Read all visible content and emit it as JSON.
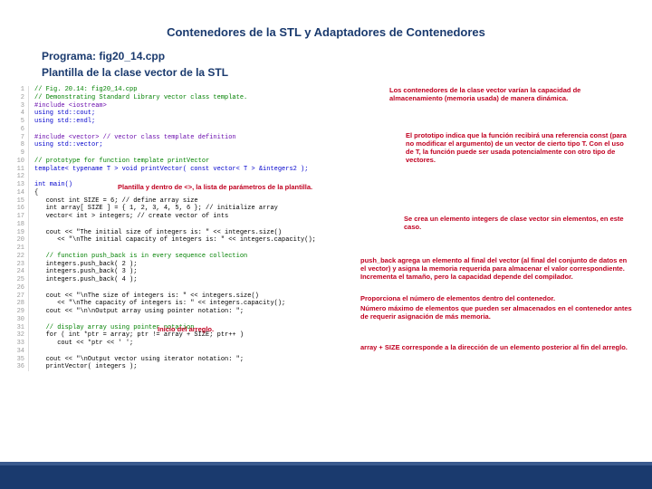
{
  "title": "Contenedores de la STL y Adaptadores de Contenedores",
  "subtitle1": "Programa: fig20_14.cpp",
  "subtitle2": "Plantilla de la clase vector de la STL",
  "code": [
    {
      "n": 1,
      "c": "// Fig. 20.14: fig20_14.cpp",
      "cls": "comment"
    },
    {
      "n": 2,
      "c": "// Demonstrating Standard Library vector class template.",
      "cls": "comment"
    },
    {
      "n": 3,
      "c": "#include <iostream>",
      "cls": "macro"
    },
    {
      "n": 4,
      "c": "using std::cout;",
      "cls": "keyword"
    },
    {
      "n": 5,
      "c": "using std::endl;",
      "cls": "keyword"
    },
    {
      "n": 6,
      "c": "",
      "cls": ""
    },
    {
      "n": 7,
      "c": "#include <vector> // vector class template definition",
      "cls": "macro"
    },
    {
      "n": 8,
      "c": "using std::vector;",
      "cls": "keyword"
    },
    {
      "n": 9,
      "c": "",
      "cls": ""
    },
    {
      "n": 10,
      "c": "// prototype for function template printVector",
      "cls": "comment"
    },
    {
      "n": 11,
      "c": "template< typename T > void printVector( const vector< T > &integers2 );",
      "cls": "keyword"
    },
    {
      "n": 12,
      "c": "",
      "cls": ""
    },
    {
      "n": 13,
      "c": "int main()",
      "cls": "keyword"
    },
    {
      "n": 14,
      "c": "{",
      "cls": ""
    },
    {
      "n": 15,
      "c": "   const int SIZE = 6; // define array size",
      "cls": ""
    },
    {
      "n": 16,
      "c": "   int array[ SIZE ] = { 1, 2, 3, 4, 5, 6 }; // initialize array",
      "cls": ""
    },
    {
      "n": 17,
      "c": "   vector< int > integers; // create vector of ints",
      "cls": ""
    },
    {
      "n": 18,
      "c": "",
      "cls": ""
    },
    {
      "n": 19,
      "c": "   cout << \"The initial size of integers is: \" << integers.size()",
      "cls": ""
    },
    {
      "n": 20,
      "c": "      << \"\\nThe initial capacity of integers is: \" << integers.capacity();",
      "cls": ""
    },
    {
      "n": 21,
      "c": "",
      "cls": ""
    },
    {
      "n": 22,
      "c": "   // function push_back is in every sequence collection",
      "cls": "comment"
    },
    {
      "n": 23,
      "c": "   integers.push_back( 2 );",
      "cls": ""
    },
    {
      "n": 24,
      "c": "   integers.push_back( 3 );",
      "cls": ""
    },
    {
      "n": 25,
      "c": "   integers.push_back( 4 );",
      "cls": ""
    },
    {
      "n": 26,
      "c": "",
      "cls": ""
    },
    {
      "n": 27,
      "c": "   cout << \"\\nThe size of integers is: \" << integers.size()",
      "cls": ""
    },
    {
      "n": 28,
      "c": "      << \"\\nThe capacity of integers is: \" << integers.capacity();",
      "cls": ""
    },
    {
      "n": 29,
      "c": "   cout << \"\\n\\nOutput array using pointer notation: \";",
      "cls": ""
    },
    {
      "n": 30,
      "c": "",
      "cls": ""
    },
    {
      "n": 31,
      "c": "   // display array using pointer notation",
      "cls": "comment"
    },
    {
      "n": 32,
      "c": "   for ( int *ptr = array; ptr != array + SIZE; ptr++ )",
      "cls": ""
    },
    {
      "n": 33,
      "c": "      cout << *ptr << ' ';",
      "cls": ""
    },
    {
      "n": 34,
      "c": "",
      "cls": ""
    },
    {
      "n": 35,
      "c": "   cout << \"\\nOutput vector using iterator notation: \";",
      "cls": ""
    },
    {
      "n": 36,
      "c": "   printVector( integers );",
      "cls": ""
    }
  ],
  "annotations": {
    "a1": "Los contenedores de la clase vector varían la capacidad de almacenamiento (memoria usada) de manera dinámica.",
    "a2": "El prototipo indica que la función recibirá una referencia const (para no modificar el argumento) de un vector de cierto tipo T. Con el uso de T, la función puede ser usada potencialmente con otro tipo de vectores.",
    "a3": "Plantilla y dentro de <>, la lista de parámetros de la plantilla.",
    "a4": "Se crea un elemento integers de clase vector sin elementos, en este caso.",
    "a5": "push_back agrega un elemento al final del vector (al final del conjunto de datos en el vector) y asigna la memoria requerida para almacenar el valor correspondiente. Incrementa el tamaño, pero la capacidad depende del compilador.",
    "a6": "Proporciona el número de elementos dentro del contenedor.",
    "a7": "Número máximo de elementos que pueden ser almacenados en el contenedor antes de requerir asignación de más memoria.",
    "a8": "Inicio del arreglo.",
    "a9": "array + SIZE corresponde a la dirección de un elemento posterior al fin del arreglo."
  }
}
